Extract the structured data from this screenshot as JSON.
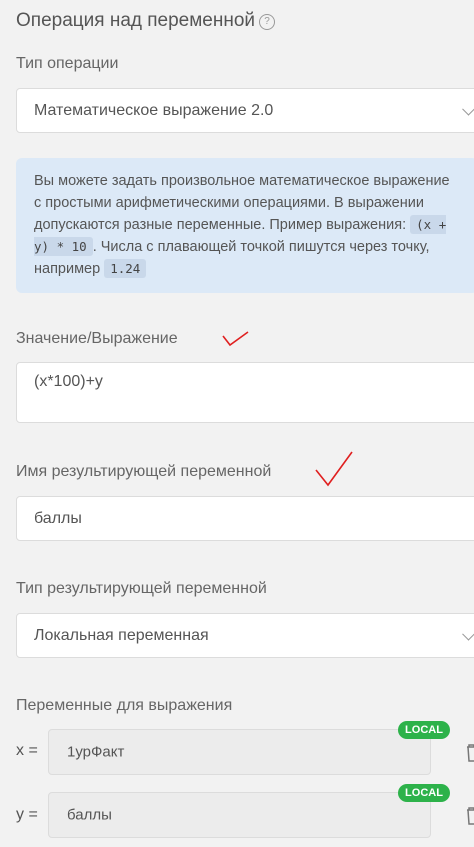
{
  "title": "Операция над переменной",
  "help_icon": "?",
  "operation_type": {
    "label": "Тип операции",
    "value": "Математическое выражение 2.0"
  },
  "info": {
    "text1": "Вы можете задать произвольное математическое выражение с простыми арифметическими операциями. В выражении допускаются разные переменные. Пример выражения: ",
    "code1": "(x + y) * 10",
    "text2": ". Числа с плавающей точкой пишутся через точку, например ",
    "code2": "1.24"
  },
  "expression": {
    "label": "Значение/Выражение",
    "value": "(x*100)+y"
  },
  "result_name": {
    "label": "Имя результирующей переменной",
    "value": "баллы"
  },
  "result_type": {
    "label": "Тип результирующей переменной",
    "value": "Локальная переменная"
  },
  "variables": {
    "label": "Переменные для выражения",
    "items": [
      {
        "name": "x =",
        "value": "1урФакт",
        "badge": "LOCAL"
      },
      {
        "name": "y =",
        "value": "баллы",
        "badge": "LOCAL"
      }
    ]
  }
}
